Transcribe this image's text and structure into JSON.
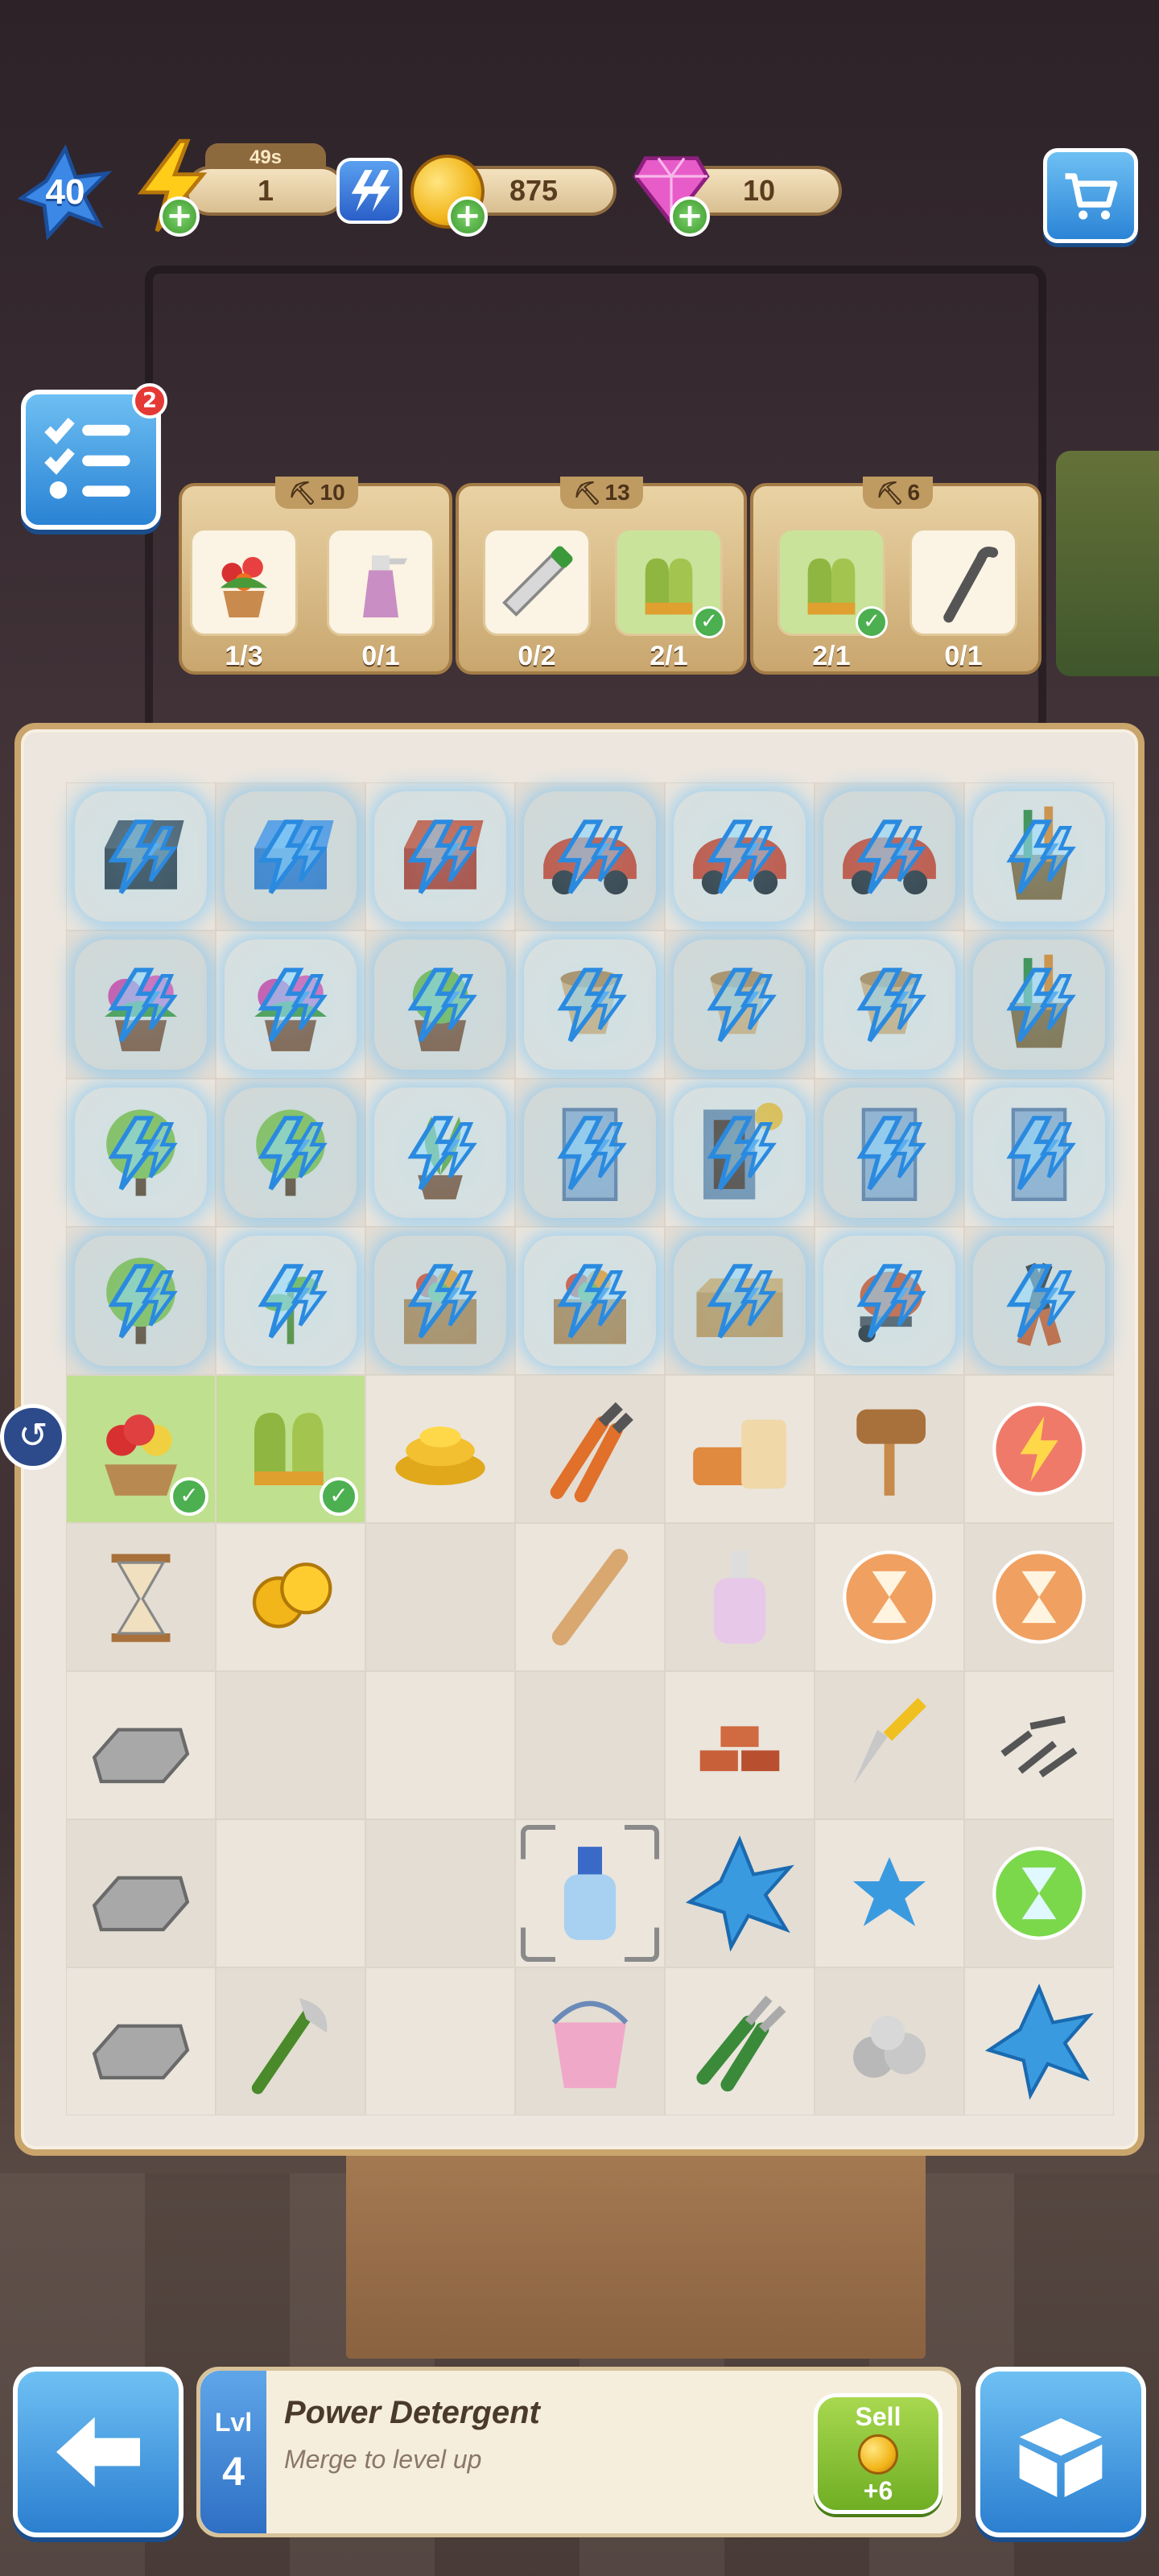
{
  "hud": {
    "player_level": "40",
    "energy_timer": "49s",
    "energy": "1",
    "coins": "875",
    "gems": "10"
  },
  "quests": {
    "badge_count": "2"
  },
  "orders": [
    {
      "pickaxe_count": "10",
      "items": [
        {
          "name": "flower-pot",
          "progress": "1/3",
          "done": false
        },
        {
          "name": "spray-bottle",
          "progress": "0/1",
          "done": false
        }
      ]
    },
    {
      "pickaxe_count": "13",
      "items": [
        {
          "name": "saw",
          "progress": "0/2",
          "done": false
        },
        {
          "name": "gloves",
          "progress": "2/1",
          "done": true
        }
      ]
    },
    {
      "pickaxe_count": "6",
      "items": [
        {
          "name": "gloves",
          "progress": "2/1",
          "done": true
        },
        {
          "name": "crowbar",
          "progress": "0/1",
          "done": false
        }
      ]
    }
  ],
  "board": {
    "rows": [
      [
        "toolbox-dark",
        "toolbox-blue",
        "toolbox-red",
        "car-red",
        "car-red",
        "car-red",
        "garden-tools-bucket"
      ],
      [
        "flower-pot-pink",
        "flower-pot-pink",
        "flower-pot-green",
        "vase",
        "vase",
        "vase",
        "garden-tools-bucket"
      ],
      [
        "bush",
        "bush",
        "plant",
        "cabinet",
        "cabinet-open",
        "cabinet",
        "cabinet"
      ],
      [
        "bush",
        "plant-small",
        "fruit-crate",
        "fruit-crate",
        "crate",
        "cement-mixer",
        "pliers"
      ],
      [
        "flower-basket",
        "gloves",
        "coin-pile",
        "pliers-orange",
        "bricks-bag",
        "mallet",
        "energy-orb"
      ],
      [
        "hourglass",
        "coins",
        "empty",
        "recorder-flute",
        "soap-bottle",
        "hourglass-orb",
        "hourglass-orb"
      ],
      [
        "stone-tile",
        "empty",
        "empty",
        "empty",
        "bricks",
        "trowel",
        "screws"
      ],
      [
        "stone-tile",
        "empty",
        "empty",
        "detergent",
        "blue-star-large",
        "blue-star-small",
        "hourglass-orb-green"
      ],
      [
        "stone-tile",
        "axe",
        "empty",
        "bucket",
        "pruning-shears",
        "rocks",
        "blue-star-large"
      ]
    ],
    "locked_rows": 4
  },
  "selected_item": {
    "level_label": "Lvl",
    "level": "4",
    "name": "Power Detergent",
    "hint": "Merge to level up",
    "sell_label": "Sell",
    "sell_value": "+6"
  },
  "colors": {
    "accent_blue": "#2b7fd0",
    "board_bg": "#ece6de",
    "order_bg": "#e9d2a4",
    "sell_green": "#6fae24"
  }
}
